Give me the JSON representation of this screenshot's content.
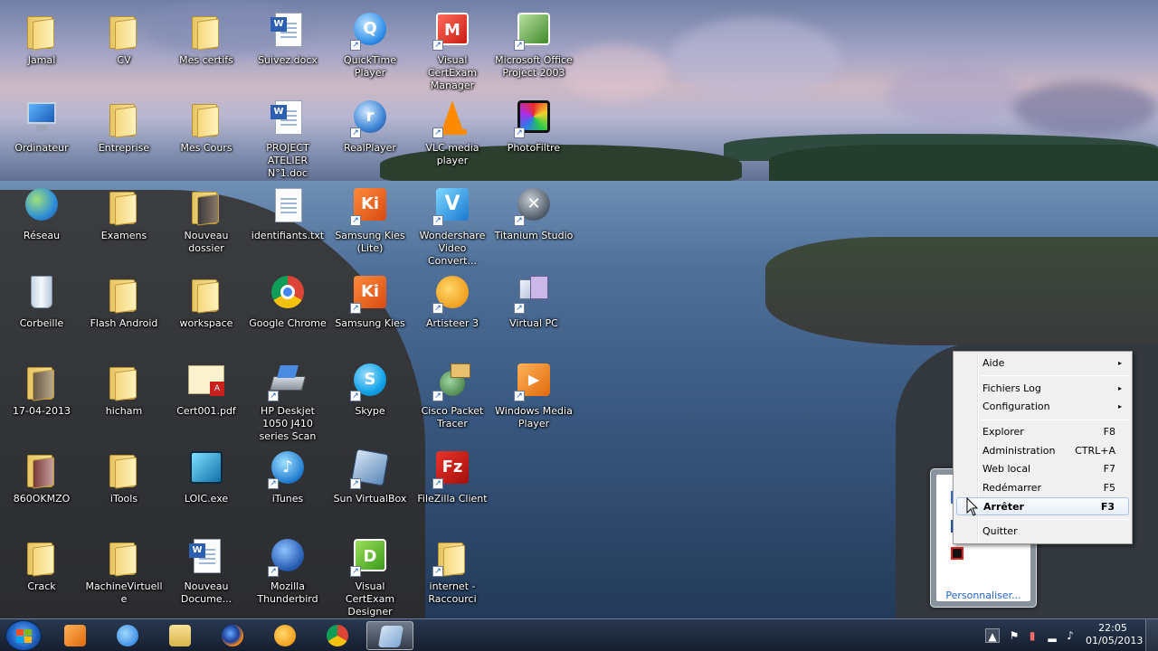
{
  "desktop": {
    "icons": [
      {
        "label": "Jamal"
      },
      {
        "label": "CV"
      },
      {
        "label": "Mes certifs"
      },
      {
        "label": "Suivez.docx"
      },
      {
        "label": "QuickTime Player"
      },
      {
        "label": "Visual CertExam Manager"
      },
      {
        "label": "Microsoft Office Project 2003"
      },
      {
        "label": "Ordinateur"
      },
      {
        "label": "Entreprise"
      },
      {
        "label": "Mes Cours"
      },
      {
        "label": "PROJECT ATELIER N°1.doc"
      },
      {
        "label": "RealPlayer"
      },
      {
        "label": "VLC media player"
      },
      {
        "label": "PhotoFiltre"
      },
      {
        "label": "Réseau"
      },
      {
        "label": "Examens"
      },
      {
        "label": "Nouveau dossier"
      },
      {
        "label": "identifiants.txt"
      },
      {
        "label": "Samsung Kies (Lite)"
      },
      {
        "label": "Wondershare Video Convert..."
      },
      {
        "label": "Titanium Studio"
      },
      {
        "label": "Corbeille"
      },
      {
        "label": "Flash Android"
      },
      {
        "label": "workspace"
      },
      {
        "label": "Google Chrome"
      },
      {
        "label": "Samsung Kies"
      },
      {
        "label": "Artisteer 3"
      },
      {
        "label": "Virtual PC"
      },
      {
        "label": "17-04-2013"
      },
      {
        "label": "hicham"
      },
      {
        "label": "Cert001.pdf"
      },
      {
        "label": "HP Deskjet 1050 J410 series Scan"
      },
      {
        "label": "Skype"
      },
      {
        "label": "Cisco Packet Tracer"
      },
      {
        "label": "Windows Media Player"
      },
      {
        "label": "860OKMZO"
      },
      {
        "label": "iTools"
      },
      {
        "label": "LOIC.exe"
      },
      {
        "label": "iTunes"
      },
      {
        "label": "Sun VirtualBox"
      },
      {
        "label": "FileZilla Client"
      },
      {
        "label": "Crack"
      },
      {
        "label": "MachineVirtuelle"
      },
      {
        "label": "Nouveau Docume..."
      },
      {
        "label": "Mozilla Thunderbird"
      },
      {
        "label": "Visual CertExam Designer"
      },
      {
        "label": "internet - Raccourci"
      }
    ]
  },
  "context_menu": {
    "items": [
      {
        "label": "Aide",
        "shortcut": "",
        "submenu": "▸"
      },
      {
        "label": "Fichiers Log",
        "shortcut": "",
        "submenu": "▸"
      },
      {
        "label": "Configuration",
        "shortcut": "",
        "submenu": "▸"
      },
      {
        "label": "Explorer",
        "shortcut": "F8"
      },
      {
        "label": "Administration",
        "shortcut": "CTRL+A"
      },
      {
        "label": "Web local",
        "shortcut": "F7"
      },
      {
        "label": "Redémarrer",
        "shortcut": "F5"
      },
      {
        "label": "Arrêter",
        "shortcut": "F3"
      },
      {
        "label": "Quitter",
        "shortcut": ""
      }
    ]
  },
  "tray_overflow": {
    "customize_label": "Personnaliser..."
  },
  "taskbar": {
    "pinned": [
      {
        "name": "windows-media-player"
      },
      {
        "name": "internet-explorer"
      },
      {
        "name": "windows-explorer"
      },
      {
        "name": "firefox"
      },
      {
        "name": "artisteer"
      },
      {
        "name": "google-chrome"
      },
      {
        "name": "active-window"
      }
    ],
    "clock": {
      "time": "22:05",
      "date": "01/05/2013"
    }
  }
}
